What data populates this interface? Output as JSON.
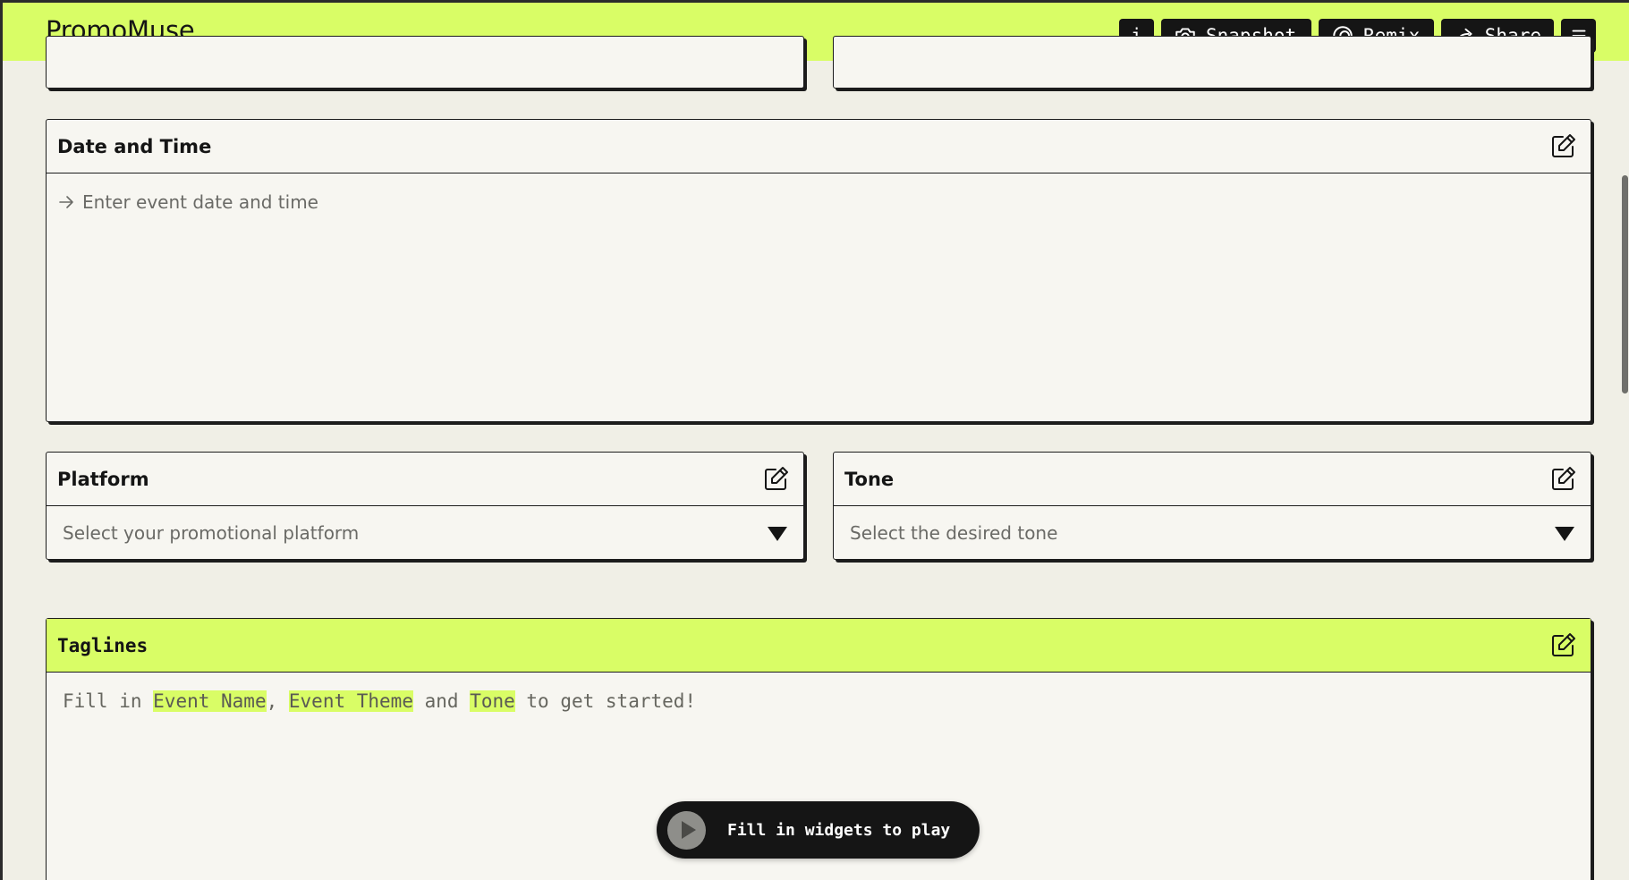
{
  "header": {
    "brand": "PromoMuse",
    "info_label": "i",
    "snapshot_label": "Snapshot",
    "remix_label": "Remix",
    "share_label": "Share"
  },
  "date_time": {
    "title": "Date and Time",
    "placeholder": "Enter event date and time"
  },
  "platform": {
    "title": "Platform",
    "placeholder": "Select your promotional platform"
  },
  "tone": {
    "title": "Tone",
    "placeholder": "Select the desired tone"
  },
  "taglines": {
    "title": "Taglines",
    "text_1": "Fill in ",
    "highlight_1": "Event Name",
    "text_2": ", ",
    "highlight_2": "Event Theme",
    "text_3": " and ",
    "highlight_3": "Tone",
    "text_4": " to get started!"
  },
  "play": {
    "label": "Fill in widgets to play"
  },
  "colors": {
    "accent": "#d9fd66",
    "background": "#f0efe6",
    "card": "#f7f6f1",
    "ink": "#151515"
  }
}
